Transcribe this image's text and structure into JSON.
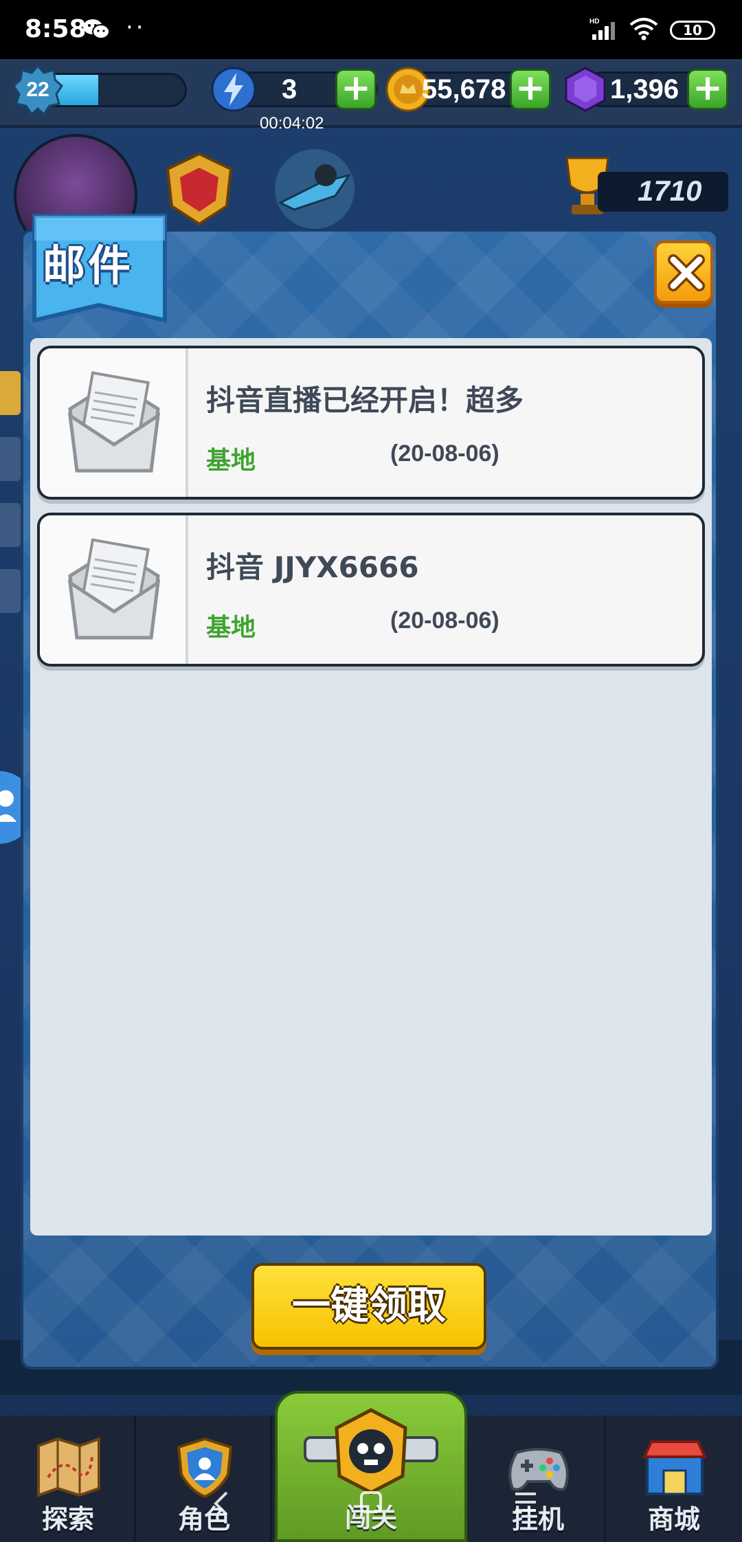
{
  "status_bar": {
    "time": "8:58",
    "dots": "··",
    "battery": "10",
    "network": "HD"
  },
  "resources": {
    "level": "22",
    "xp_fraction": 0.4,
    "energy": "3",
    "energy_timer": "00:04:02",
    "gold": "55,678",
    "gems": "1,396"
  },
  "background": {
    "trophy_score": "1710"
  },
  "dialog": {
    "title": "邮件",
    "mails": [
      {
        "title": "抖音直播已经开启！超多",
        "source": "基地",
        "date": "(20-08-06)"
      },
      {
        "title": "抖音 JJYX6666",
        "source": "基地",
        "date": "(20-08-06)"
      }
    ],
    "claim_all_label": "一键领取"
  },
  "bottom_nav": {
    "items": [
      {
        "label": "探索",
        "icon": "map-icon"
      },
      {
        "label": "角色",
        "icon": "shield-icon"
      },
      {
        "label": "闯关",
        "icon": "skull-icon"
      },
      {
        "label": "挂机",
        "icon": "gamepad-icon"
      },
      {
        "label": "商城",
        "icon": "shop-icon"
      }
    ]
  },
  "colors": {
    "dialog_blue": "#2f6aa9",
    "source_green": "#3fa32f",
    "claim_yellow": "#f6c200",
    "close_orange": "#f39b0c"
  }
}
